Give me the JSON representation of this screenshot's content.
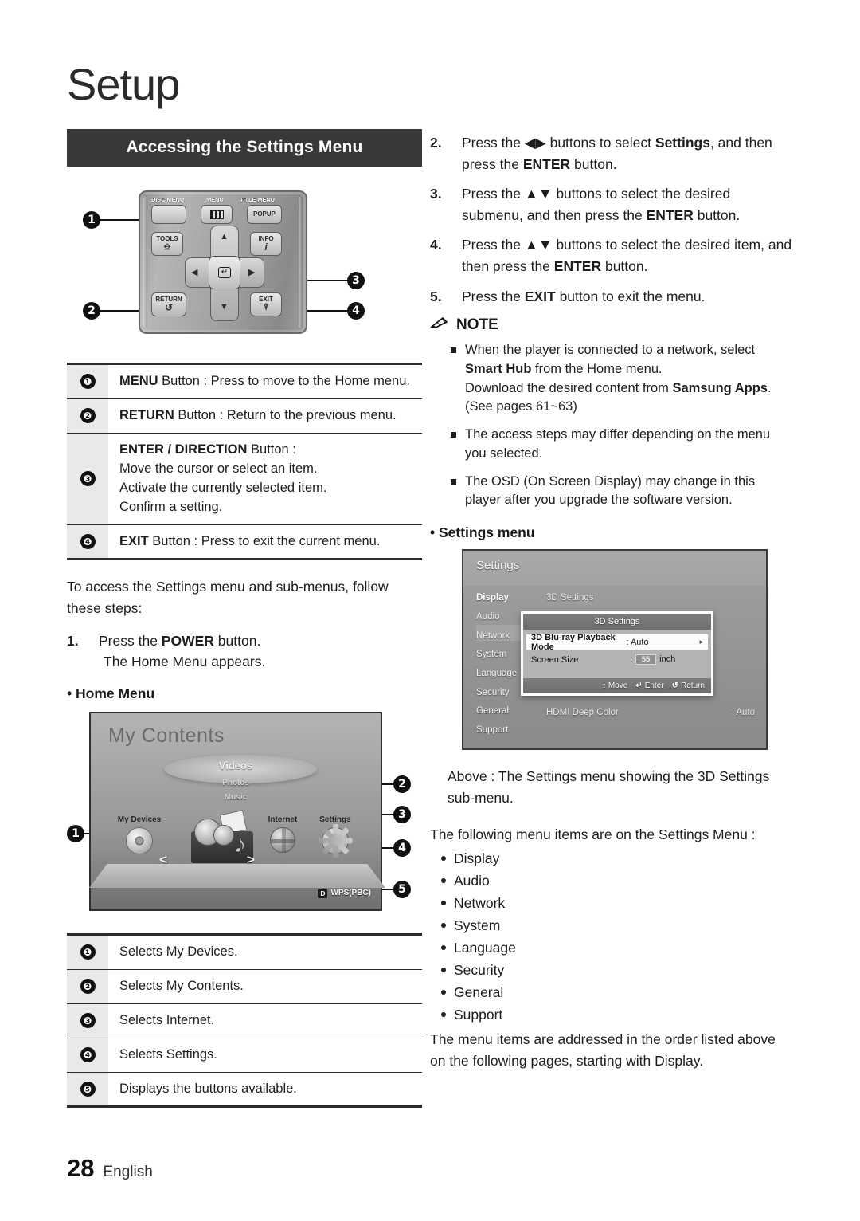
{
  "chapter": {
    "title": "Setup"
  },
  "section": {
    "banner": "Accessing the Settings Menu"
  },
  "remote": {
    "labels": {
      "disc_menu": "DISC MENU",
      "menu": "MENU",
      "title_menu": "TITLE MENU"
    },
    "buttons": {
      "popup": "POPUP",
      "tools": "TOOLS",
      "info": "INFO",
      "info_glyph": "i",
      "return": "RETURN",
      "exit": "EXIT",
      "enter_glyph": "↵",
      "return_glyph": "↺",
      "up": "▲",
      "down": "▼",
      "left": "◀",
      "right": "▶"
    },
    "callouts": [
      "1",
      "2",
      "3",
      "4"
    ]
  },
  "button_table": [
    {
      "num": "❶",
      "bold": "MENU",
      "rest": " Button : Press to move to the Home menu.",
      "lines": []
    },
    {
      "num": "❷",
      "bold": "RETURN",
      "rest": " Button : Return to the previous menu.",
      "lines": []
    },
    {
      "num": "❸",
      "bold": "ENTER / DIRECTION",
      "rest": " Button :",
      "lines": [
        "Move the cursor or select an item.",
        "Activate the currently selected item.",
        "Confirm a setting."
      ]
    },
    {
      "num": "❹",
      "bold": "EXIT",
      "rest": " Button : Press to exit the current menu.",
      "lines": []
    }
  ],
  "left_intro": "To access the Settings menu and sub-menus, follow these steps:",
  "step1": {
    "number": "1.",
    "pre": "Press the ",
    "bold": "POWER",
    "post": " button.",
    "line2": "The Home Menu appears."
  },
  "home_menu_heading": "• Home Menu",
  "home_menu": {
    "title": "My Contents",
    "carousel": [
      "Videos",
      "Photos",
      "Music"
    ],
    "items": [
      {
        "label": "My Devices",
        "icon": "disc-icon"
      },
      {
        "label": "Internet",
        "icon": "globe-icon"
      },
      {
        "label": "Settings",
        "icon": "gear-icon"
      }
    ],
    "prev_arrow": "<",
    "next_arrow": ">",
    "wps_key": "D",
    "wps_label": "WPS(PBC)",
    "callouts": [
      "1",
      "2",
      "3",
      "4",
      "5"
    ]
  },
  "home_table": [
    {
      "num": "❶",
      "text": "Selects My Devices."
    },
    {
      "num": "❷",
      "text": "Selects My Contents."
    },
    {
      "num": "❸",
      "text": "Selects Internet."
    },
    {
      "num": "❹",
      "text": "Selects Settings."
    },
    {
      "num": "❺",
      "text": "Displays the buttons available."
    }
  ],
  "right_steps": [
    {
      "number": "2.",
      "parts": [
        {
          "t": "Press the ",
          "b": false
        },
        {
          "t": "◀▶",
          "b": false
        },
        {
          "t": " buttons to select ",
          "b": false
        },
        {
          "t": "Settings",
          "b": true
        },
        {
          "t": ", and then press the ",
          "b": false
        },
        {
          "t": "ENTER",
          "b": true
        },
        {
          "t": " button.",
          "b": false
        }
      ]
    },
    {
      "number": "3.",
      "parts": [
        {
          "t": "Press the ",
          "b": false
        },
        {
          "t": "▲▼",
          "b": false
        },
        {
          "t": " buttons to select the desired submenu, and then press the ",
          "b": false
        },
        {
          "t": "ENTER",
          "b": true
        },
        {
          "t": " button.",
          "b": false
        }
      ]
    },
    {
      "number": "4.",
      "parts": [
        {
          "t": "Press the ",
          "b": false
        },
        {
          "t": "▲▼",
          "b": false
        },
        {
          "t": " buttons to select the desired item, and then press the ",
          "b": false
        },
        {
          "t": "ENTER",
          "b": true
        },
        {
          "t": " button.",
          "b": false
        }
      ]
    },
    {
      "number": "5.",
      "parts": [
        {
          "t": "Press the ",
          "b": false
        },
        {
          "t": "EXIT",
          "b": true
        },
        {
          "t": " button to exit the menu.",
          "b": false
        }
      ]
    }
  ],
  "note": {
    "heading": "NOTE",
    "icon": "pencil-icon",
    "items": [
      [
        {
          "t": "When the player is connected to a network, select ",
          "b": false
        },
        {
          "t": "Smart Hub",
          "b": true
        },
        {
          "t": " from the Home menu.",
          "b": false
        },
        {
          "t": "\n",
          "b": false
        },
        {
          "t": "Download the desired content from ",
          "b": false
        },
        {
          "t": "Samsung Apps",
          "b": true
        },
        {
          "t": ". (See pages 61~63)",
          "b": false
        }
      ],
      [
        {
          "t": "The access steps may differ depending on the menu you selected.",
          "b": false
        }
      ],
      [
        {
          "t": "The OSD (On Screen Display) may change in this player after you upgrade the software version.",
          "b": false
        }
      ]
    ]
  },
  "settings_menu_heading": "• Settings menu",
  "settings_tv": {
    "title": "Settings",
    "sidebar": [
      "Display",
      "Audio",
      "Network",
      "System",
      "Language",
      "Security",
      "General",
      "Support"
    ],
    "selected_sidebar": "Display",
    "rows": [
      {
        "label": "3D Settings",
        "value": ""
      },
      {
        "label": "HDMI Deep Color",
        "value": ": Auto"
      }
    ],
    "dialog": {
      "title": "3D Settings",
      "rows": [
        {
          "name": "3D Blu-ray Playback Mode",
          "value": ": Auto",
          "caret": "▸",
          "highlight": true
        },
        {
          "name": "Screen Size",
          "value_prefix": ":",
          "value_box": "55",
          "value_suffix": "inch",
          "highlight": false
        }
      ],
      "footer": [
        {
          "glyph": "↕",
          "label": "Move"
        },
        {
          "glyph": "↵",
          "label": "Enter"
        },
        {
          "glyph": "↺",
          "label": "Return"
        }
      ]
    }
  },
  "caption_above": "Above : The Settings menu showing the 3D Settings sub-menu.",
  "following_intro": "The following menu items are on the Settings Menu :",
  "settings_items": [
    "Display",
    "Audio",
    "Network",
    "System",
    "Language",
    "Security",
    "General",
    "Support"
  ],
  "closing": "The menu items are addressed in the order listed above on the following pages, starting with Display.",
  "footer": {
    "page": "28",
    "language": "English"
  }
}
